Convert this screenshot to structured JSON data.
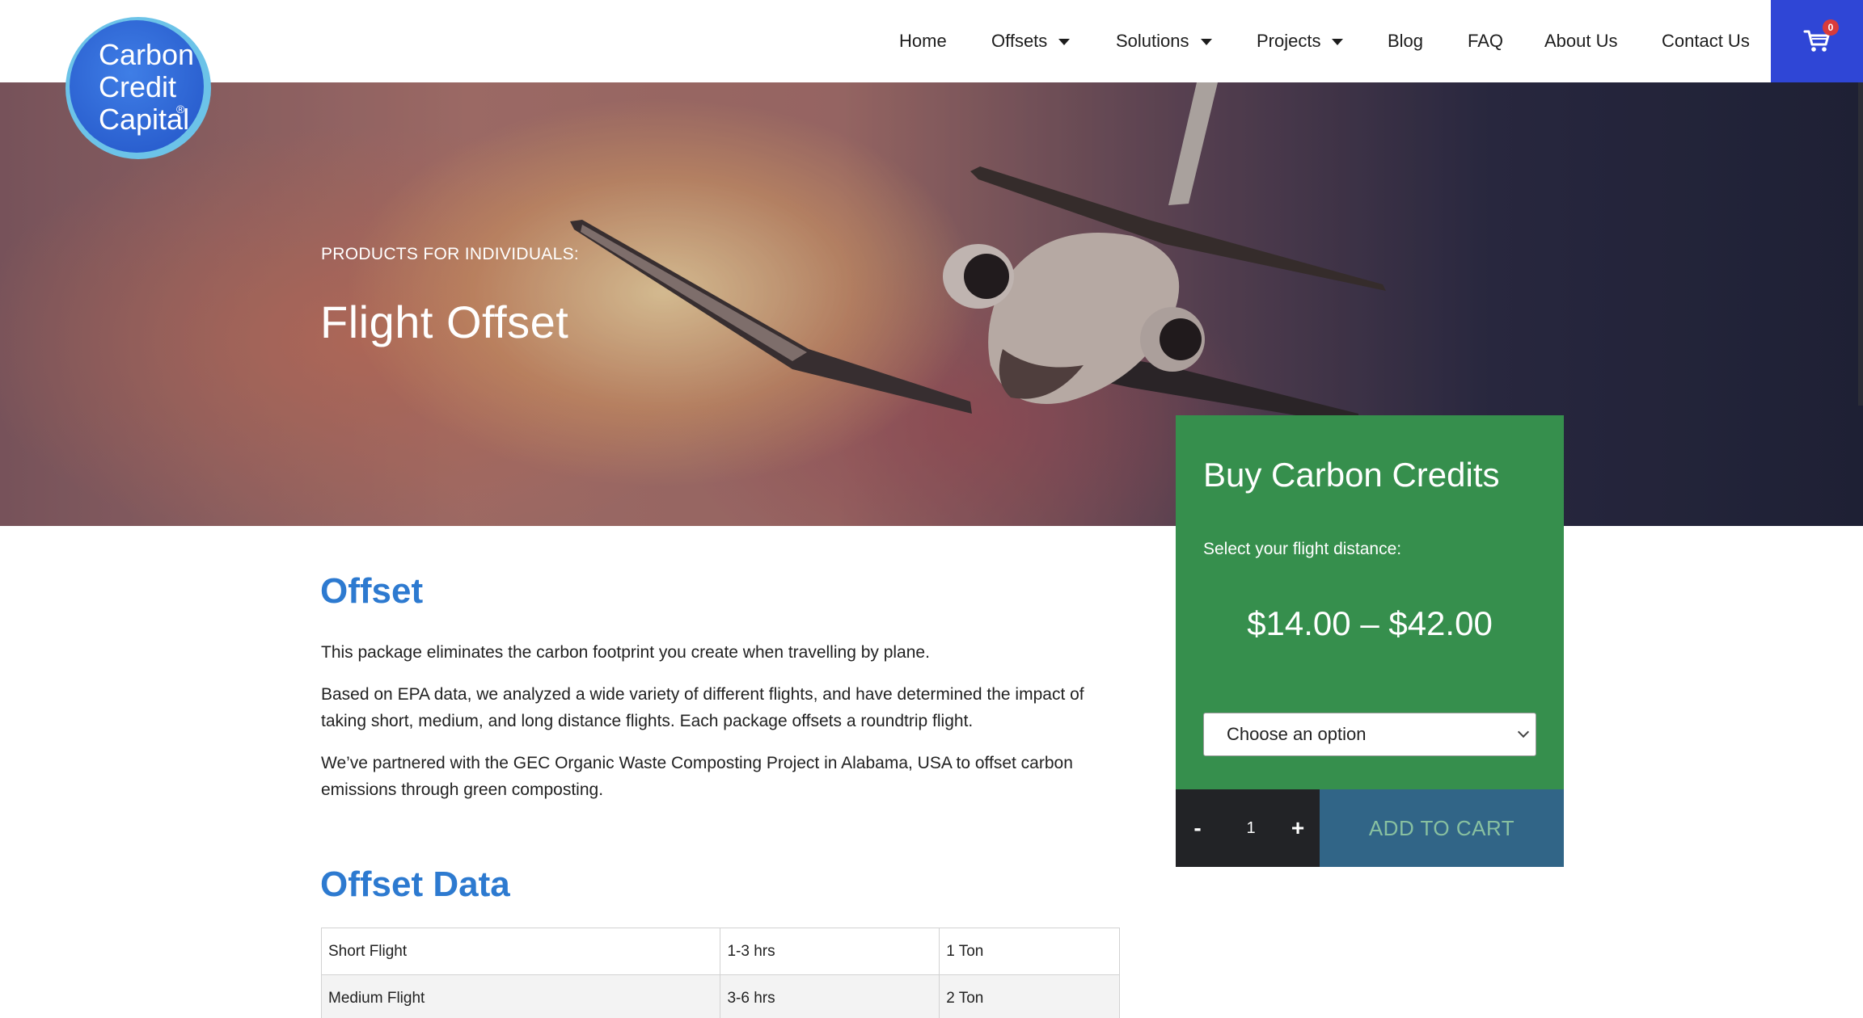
{
  "logo": {
    "line1": "Carbon",
    "line2": "Credit",
    "line3": "Capital",
    "reg": "®"
  },
  "nav": {
    "items": [
      {
        "label": "Home",
        "dropdown": false
      },
      {
        "label": "Offsets",
        "dropdown": true
      },
      {
        "label": "Solutions",
        "dropdown": true
      },
      {
        "label": "Projects",
        "dropdown": true
      },
      {
        "label": "Blog",
        "dropdown": false
      },
      {
        "label": "FAQ",
        "dropdown": false
      },
      {
        "label": "About Us",
        "dropdown": false
      },
      {
        "label": "Contact Us",
        "dropdown": false
      }
    ],
    "cart_count": "0"
  },
  "hero": {
    "kicker": "PRODUCTS FOR INDIVIDUALS:",
    "title": "Flight Offset"
  },
  "buy_box": {
    "title": "Buy Carbon Credits",
    "subtitle": "Select your flight distance:",
    "price": "$14.00 – $42.00",
    "select_value": "Choose an option",
    "qty_minus": "-",
    "qty_value": "1",
    "qty_plus": "+",
    "add_to_cart": "ADD TO CART"
  },
  "offset": {
    "heading": "Offset",
    "p1": "This package eliminates the carbon footprint you create when travelling by plane.",
    "p2": "Based on EPA data, we analyzed a wide variety of different flights, and have determined the impact of taking short, medium, and long distance flights. Each package offsets a roundtrip flight.",
    "p3": "We’ve partnered with the GEC Organic Waste Composting Project in Alabama, USA to offset carbon emissions through green composting."
  },
  "offset_data": {
    "heading": "Offset Data",
    "rows": [
      [
        "Short Flight",
        "1-3 hrs",
        "1 Ton"
      ],
      [
        "Medium Flight",
        "3-6 hrs",
        "2 Ton"
      ]
    ]
  },
  "colors": {
    "brand_blue": "#2f46d6",
    "heading_blue": "#2d7ad0",
    "buy_green": "#368f4d",
    "cart_button": "#316587"
  }
}
